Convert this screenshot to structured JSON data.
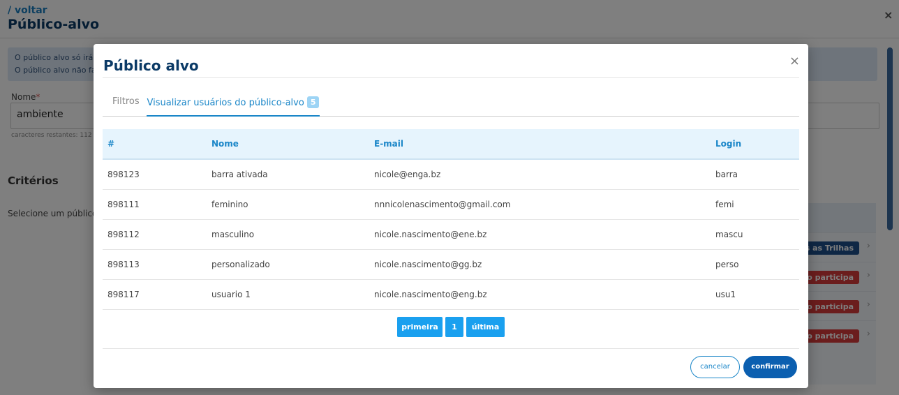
{
  "background": {
    "back_link": "/ voltar",
    "page_title": "Público-alvo",
    "close_icon": "×",
    "info_line_1": "O público alvo só irá a",
    "info_line_2": "O público alvo não faz",
    "nome_label": "Nome",
    "required_mark": "*",
    "nome_value": "ambiente",
    "chars_left": "caracteres restantes: 112",
    "criterios_title": "Critérios",
    "select_publico": "Selecione um público:",
    "rows": [
      {
        "status": "as as Trilhas",
        "color": "#1c4f8a"
      },
      {
        "status": "ão participa",
        "color": "#d73a3a"
      },
      {
        "status": "ão participa",
        "color": "#d73a3a"
      },
      {
        "status": "ão participa",
        "color": "#d73a3a"
      }
    ],
    "chevron_icon": "›"
  },
  "modal": {
    "title": "Público alvo",
    "close_icon": "×",
    "tabs": {
      "filtros": "Filtros",
      "usuarios": "Visualizar usuários do público-alvo",
      "usuarios_count": "5"
    },
    "table": {
      "headers": [
        "#",
        "Nome",
        "E-mail",
        "Login"
      ],
      "rows": [
        [
          "898123",
          "barra ativada",
          "nicole@enga.bz",
          "barra"
        ],
        [
          "898111",
          "feminino",
          "nnnicolenascimento@gmail.com",
          "femi"
        ],
        [
          "898112",
          "masculino",
          "nicole.nascimento@ene.bz",
          "mascu"
        ],
        [
          "898113",
          "personalizado",
          "nicole.nascimento@gg.bz",
          "perso"
        ],
        [
          "898117",
          "usuario 1",
          "nicole.nascimento@eng.bz",
          "usu1"
        ]
      ]
    },
    "pagination": {
      "first": "primeira",
      "current": "1",
      "last": "última"
    },
    "buttons": {
      "cancel": "cancelar",
      "confirm": "confirmar"
    }
  },
  "colors": {
    "accent": "#1a86c8",
    "title": "#0b3a66",
    "pager": "#1aa0ef",
    "confirm": "#0b5fb0"
  }
}
